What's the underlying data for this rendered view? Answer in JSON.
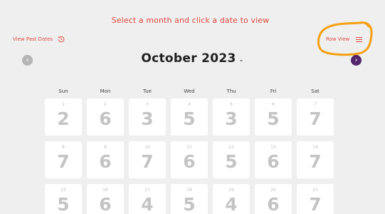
{
  "header": {
    "prompt": "Select a month and click a date to view",
    "view_past_dates": "View Past Dates",
    "row_view": "Row View",
    "history_icon": "history-icon",
    "list_icon": "list-icon"
  },
  "nav": {
    "month_title": "October 2023",
    "caret": "⌄",
    "prev": "‹",
    "next": "›",
    "prev_color": "#b5b5b5",
    "next_color": "#53266b"
  },
  "accent_color": "#e0493f",
  "annotation_color": "#f5a014",
  "weekdays": [
    "Sun",
    "Mon",
    "Tue",
    "Wed",
    "Thu",
    "Fri",
    "Sat"
  ],
  "calendar": [
    [
      {
        "date": "1",
        "value": "2"
      },
      {
        "date": "2",
        "value": "6"
      },
      {
        "date": "3",
        "value": "3"
      },
      {
        "date": "4",
        "value": "5"
      },
      {
        "date": "5",
        "value": "3"
      },
      {
        "date": "6",
        "value": "5"
      },
      {
        "date": "7",
        "value": "7"
      }
    ],
    [
      {
        "date": "8",
        "value": "7"
      },
      {
        "date": "9",
        "value": "6"
      },
      {
        "date": "10",
        "value": "7"
      },
      {
        "date": "11",
        "value": "6"
      },
      {
        "date": "12",
        "value": "5"
      },
      {
        "date": "13",
        "value": "6"
      },
      {
        "date": "14",
        "value": "7"
      }
    ],
    [
      {
        "date": "15",
        "value": "5"
      },
      {
        "date": "16",
        "value": "6"
      },
      {
        "date": "17",
        "value": "4"
      },
      {
        "date": "18",
        "value": "5"
      },
      {
        "date": "19",
        "value": "4"
      },
      {
        "date": "20",
        "value": "6"
      },
      {
        "date": "21",
        "value": "7"
      }
    ]
  ]
}
